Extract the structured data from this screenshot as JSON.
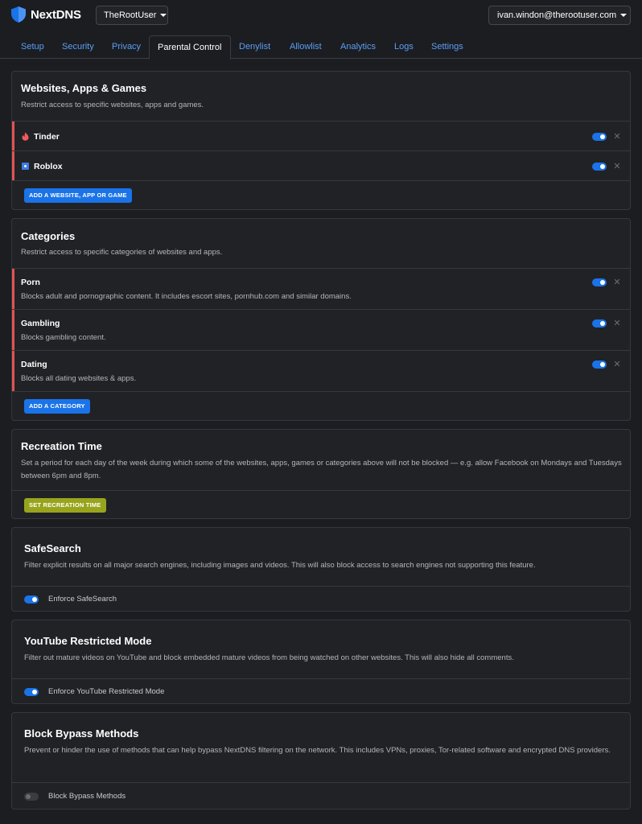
{
  "header": {
    "brand": "NextDNS",
    "configuration": "TheRootUser",
    "account": "ivan.windon@therootuser.com"
  },
  "tabs": [
    {
      "label": "Setup",
      "active": false
    },
    {
      "label": "Security",
      "active": false
    },
    {
      "label": "Privacy",
      "active": false
    },
    {
      "label": "Parental Control",
      "active": true
    },
    {
      "label": "Denylist",
      "active": false
    },
    {
      "label": "Allowlist",
      "active": false
    },
    {
      "label": "Analytics",
      "active": false
    },
    {
      "label": "Logs",
      "active": false
    },
    {
      "label": "Settings",
      "active": false
    }
  ],
  "websites": {
    "title": "Websites, Apps & Games",
    "description": "Restrict access to specific websites, apps and games.",
    "items": [
      {
        "name": "Tinder",
        "icon": "tinder-icon",
        "enabled": true
      },
      {
        "name": "Roblox",
        "icon": "roblox-icon",
        "enabled": true
      }
    ],
    "add_label": "ADD A WEBSITE, APP OR GAME"
  },
  "categories": {
    "title": "Categories",
    "description": "Restrict access to specific categories of websites and apps.",
    "items": [
      {
        "name": "Porn",
        "description": "Blocks adult and pornographic content. It includes escort sites, pornhub.com and similar domains.",
        "enabled": true
      },
      {
        "name": "Gambling",
        "description": "Blocks gambling content.",
        "enabled": true
      },
      {
        "name": "Dating",
        "description": "Blocks all dating websites & apps.",
        "enabled": true
      }
    ],
    "add_label": "ADD A CATEGORY"
  },
  "recreation": {
    "title": "Recreation Time",
    "description": "Set a period for each day of the week during which some of the websites, apps, games or categories above will not be blocked — e.g. allow Facebook on Mondays and Tuesdays between 6pm and 8pm.",
    "button_label": "SET RECREATION TIME"
  },
  "safesearch": {
    "title": "SafeSearch",
    "description": "Filter explicit results on all major search engines, including images and videos. This will also block access to search engines not supporting this feature.",
    "toggle_label": "Enforce SafeSearch",
    "enabled": true
  },
  "youtube": {
    "title": "YouTube Restricted Mode",
    "description": "Filter out mature videos on YouTube and block embedded mature videos from being watched on other websites. This will also hide all comments.",
    "toggle_label": "Enforce YouTube Restricted Mode",
    "enabled": true
  },
  "bypass": {
    "title": "Block Bypass Methods",
    "description": "Prevent or hinder the use of methods that can help bypass NextDNS filtering on the network. This includes VPNs, proxies, Tor-related software and encrypted DNS providers.",
    "toggle_label": "Block Bypass Methods",
    "enabled": false
  },
  "colors": {
    "accent_blue": "#1a73e8",
    "link_blue": "#5a9ef7",
    "recreation_olive": "#98a51c",
    "active_row_bar": "#e25252"
  },
  "remove_glyph": "✕"
}
